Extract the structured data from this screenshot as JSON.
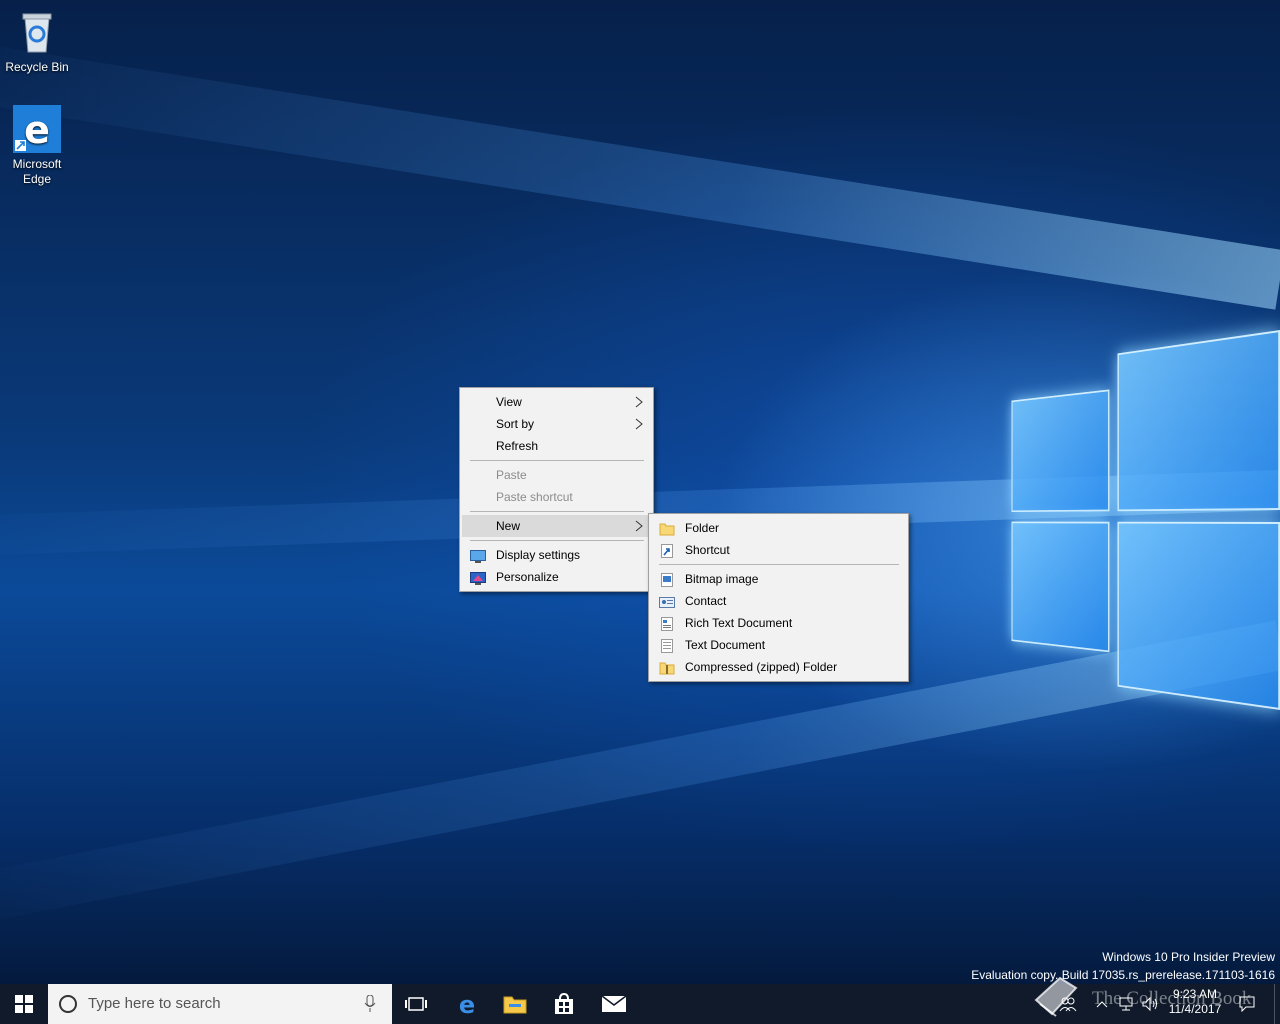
{
  "desktop_icons": [
    {
      "label": "Recycle Bin",
      "icon": "recycle-bin-icon"
    },
    {
      "label": "Microsoft Edge",
      "icon": "edge-icon"
    }
  ],
  "context_menu": {
    "items": [
      {
        "label": "View",
        "submenu": true
      },
      {
        "label": "Sort by",
        "submenu": true
      },
      {
        "label": "Refresh"
      },
      {
        "label": "Paste",
        "disabled": true
      },
      {
        "label": "Paste shortcut",
        "disabled": true
      },
      {
        "label": "New",
        "submenu": true,
        "highlighted": true
      },
      {
        "label": "Display settings",
        "icon": "display-settings-icon"
      },
      {
        "label": "Personalize",
        "icon": "personalize-icon"
      }
    ]
  },
  "new_submenu": {
    "items": [
      {
        "label": "Folder",
        "icon": "folder-icon"
      },
      {
        "label": "Shortcut",
        "icon": "shortcut-icon"
      },
      {
        "label": "Bitmap image",
        "icon": "bitmap-icon"
      },
      {
        "label": "Contact",
        "icon": "contact-icon"
      },
      {
        "label": "Rich Text Document",
        "icon": "rich-text-icon"
      },
      {
        "label": "Text Document",
        "icon": "text-document-icon"
      },
      {
        "label": "Compressed (zipped) Folder",
        "icon": "zip-folder-icon"
      }
    ]
  },
  "watermark": {
    "line1": "Windows 10 Pro Insider Preview",
    "line2": "Evaluation copy. Build 17035.rs_prerelease.171103-1616"
  },
  "taskbar": {
    "search_placeholder": "Type here to search",
    "clock_time": "9:23 AM",
    "clock_date": "11/4/2017",
    "overlay_text": "The Collection Book",
    "pinned": [
      "task-view-icon",
      "edge-icon",
      "file-explorer-icon",
      "store-icon",
      "mail-icon"
    ]
  },
  "colors": {
    "accent": "#0078d7",
    "taskbar": "#101a2a",
    "menu_bg": "#f2f2f2"
  }
}
